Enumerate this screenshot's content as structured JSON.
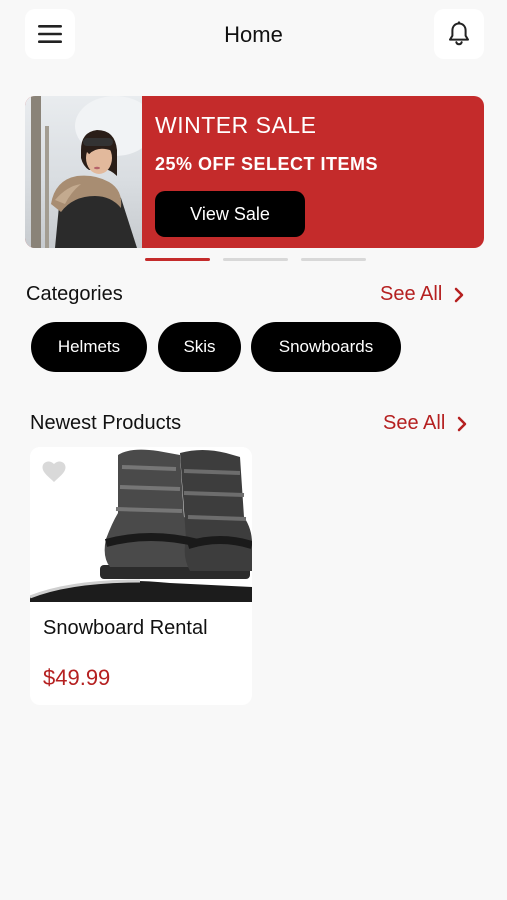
{
  "header": {
    "title": "Home",
    "menu_icon": "hamburger-menu-icon",
    "notification_icon": "bell-icon"
  },
  "banner": {
    "headline": "WINTER SALE",
    "offer": "25% OFF SELECT ITEMS",
    "button_label": "View Sale",
    "background_color": "#c42b2b",
    "slides_total": 3,
    "active_slide": 1
  },
  "categories": {
    "title": "Categories",
    "see_all": "See All",
    "items": [
      {
        "label": "Helmets"
      },
      {
        "label": "Skis"
      },
      {
        "label": "Snowboards"
      }
    ]
  },
  "newest_products": {
    "title": "Newest Products",
    "see_all": "See All",
    "items": [
      {
        "name": "Snowboard Rental",
        "price": "$49.99",
        "favorite": false
      }
    ]
  },
  "colors": {
    "accent": "#b52020",
    "background": "#f8f8f8",
    "chip": "#000000"
  }
}
